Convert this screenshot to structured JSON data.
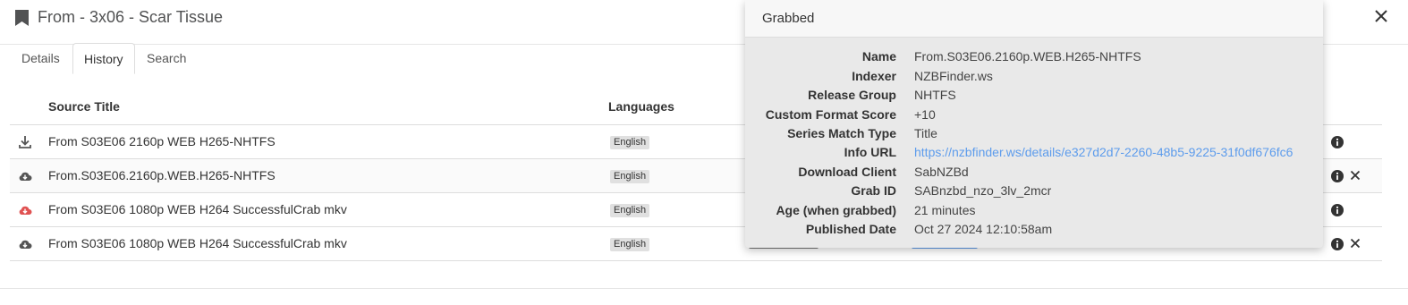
{
  "modal": {
    "title": "From - 3x06 - Scar Tissue"
  },
  "tabs": [
    {
      "label": "Details",
      "active": false
    },
    {
      "label": "History",
      "active": true
    },
    {
      "label": "Search",
      "active": false
    }
  ],
  "table": {
    "headers": {
      "source_title": "Source Title",
      "languages": "Languages"
    },
    "rows": [
      {
        "icon": "download-icon",
        "title": "From S03E06 2160p WEB H265-NHTFS",
        "language": "English",
        "removable": false
      },
      {
        "icon": "cloud-download-icon",
        "title": "From.S03E06.2160p.WEB.H265-NHTFS",
        "language": "English",
        "removable": true
      },
      {
        "icon": "cloud-download-failed-icon",
        "title": "From S03E06 1080p WEB H264 SuccessfulCrab mkv",
        "language": "English",
        "removable": false
      },
      {
        "icon": "cloud-download-icon",
        "title": "From S03E06 1080p WEB H264 SuccessfulCrab mkv",
        "language": "English",
        "removable": true
      }
    ]
  },
  "popover": {
    "title": "Grabbed",
    "details": [
      {
        "label": "Name",
        "value": "From.S03E06.2160p.WEB.H265-NHTFS"
      },
      {
        "label": "Indexer",
        "value": "NZBFinder.ws"
      },
      {
        "label": "Release Group",
        "value": "NHTFS"
      },
      {
        "label": "Custom Format Score",
        "value": "+10"
      },
      {
        "label": "Series Match Type",
        "value": "Title"
      },
      {
        "label": "Info URL",
        "value": "https://nzbfinder.ws/details/e327d2d7-2260-48b5-9225-31f0df676fc6"
      },
      {
        "label": "Download Client",
        "value": "SabNZBd"
      },
      {
        "label": "Grab ID",
        "value": "SABnzbd_nzo_3lv_2mcr"
      },
      {
        "label": "Age (when grabbed)",
        "value": "21 minutes"
      },
      {
        "label": "Published Date",
        "value": "Oct 27 2024 12:10:58am"
      }
    ]
  },
  "colors": {
    "link": "#5d9cec",
    "failed_icon": "#e05252",
    "icon": "#555555"
  }
}
